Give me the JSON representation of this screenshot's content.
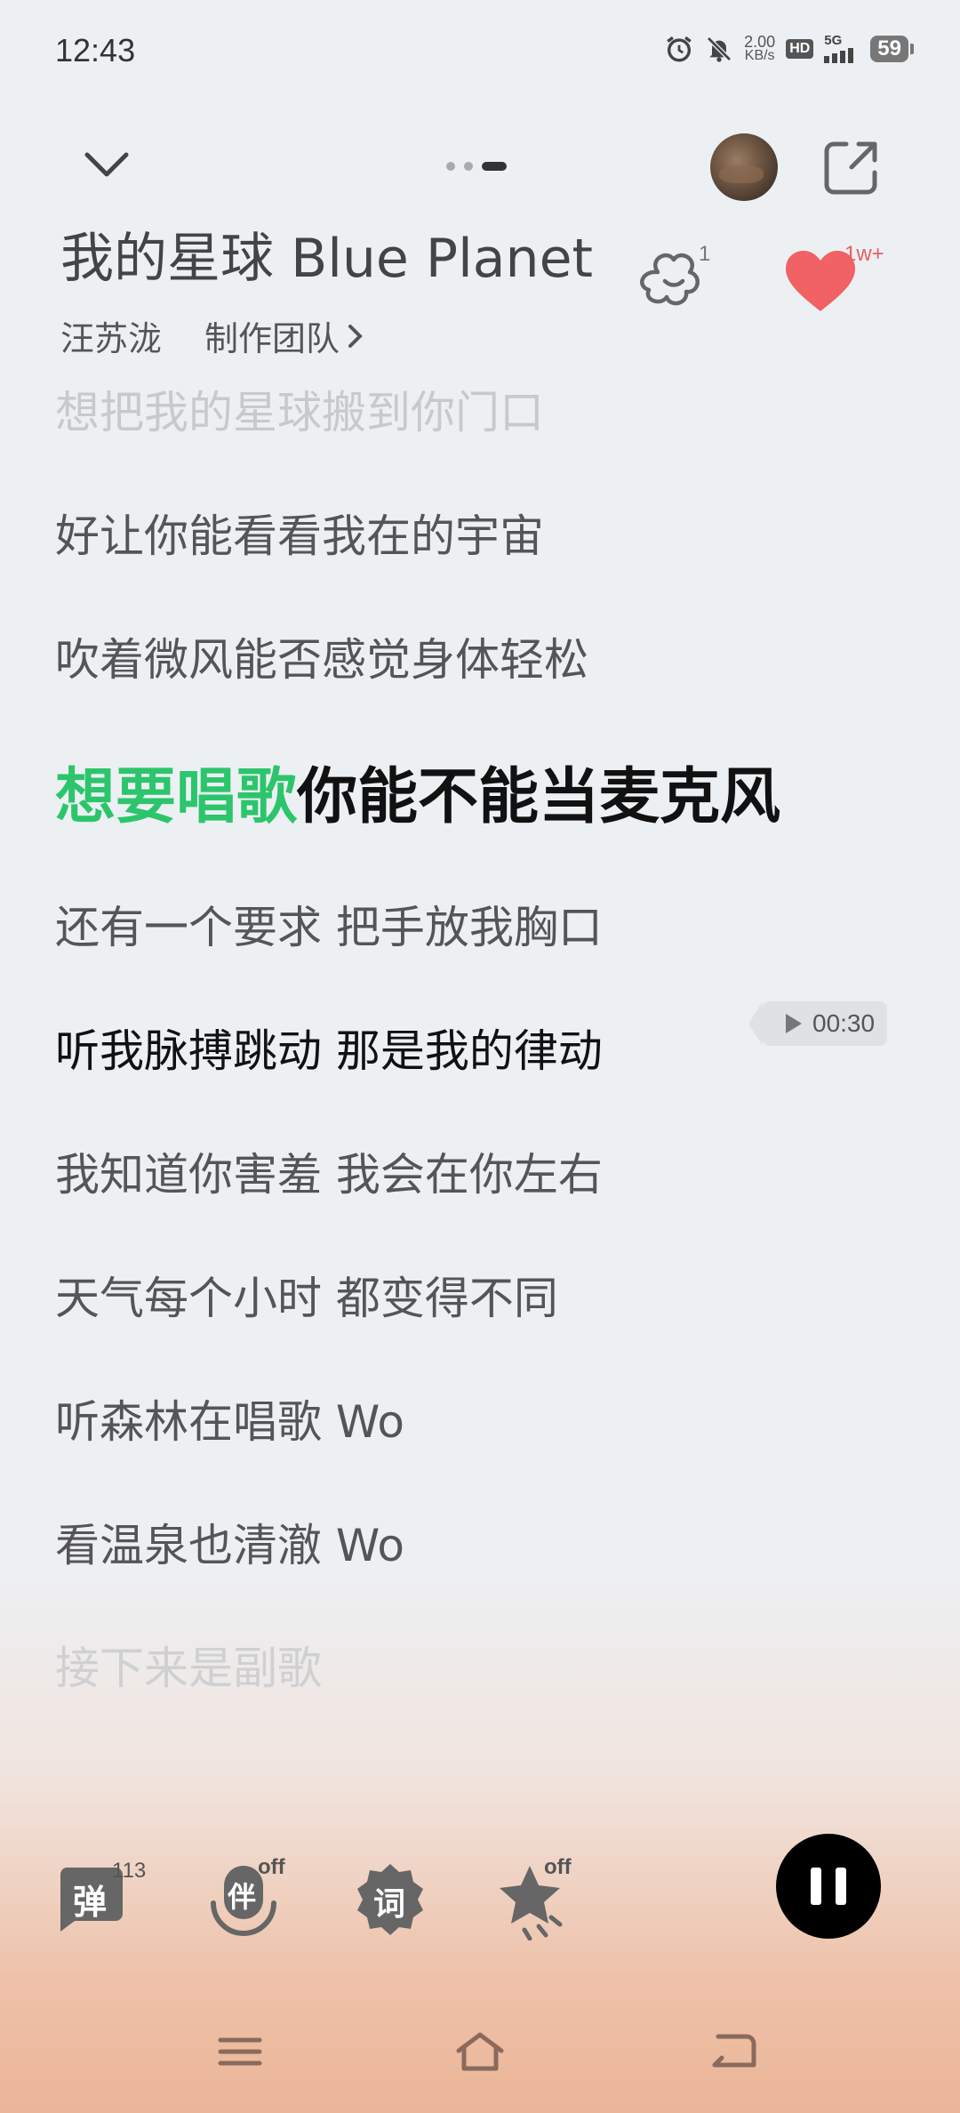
{
  "status_bar": {
    "time": "12:43",
    "net_speed_value": "2.00",
    "net_speed_unit": "KB/s",
    "hd_label": "HD",
    "network_label": "5G",
    "battery": "59"
  },
  "header": {
    "song_title": "我的星球 Blue Planet",
    "artist": "汪苏泷",
    "crew_label": "制作团队",
    "comment_count": "1",
    "like_count": "1w+"
  },
  "lyrics": [
    {
      "text": "想把我的星球搬到你门口",
      "state": "faded"
    },
    {
      "text": "好让你能看看我在的宇宙",
      "state": "normal"
    },
    {
      "text": "吹着微风能否感觉身体轻松",
      "state": "normal"
    },
    {
      "sung": "想要唱歌",
      "rest": "你能不能当麦克风",
      "state": "current"
    },
    {
      "text": "还有一个要求 把手放我胸口",
      "state": "normal"
    },
    {
      "text": "听我脉搏跳动 那是我的律动",
      "state": "dark"
    },
    {
      "text": "我知道你害羞 我会在你左右",
      "state": "normal"
    },
    {
      "text": "天气每个小时 都变得不同",
      "state": "normal"
    },
    {
      "text": "听森林在唱歌 Wo",
      "state": "normal"
    },
    {
      "text": "看温泉也清澈 Wo",
      "state": "normal"
    },
    {
      "text": "接下来是副歌",
      "state": "faded"
    }
  ],
  "seek_tag": {
    "time": "00:30"
  },
  "controls": {
    "danmu_label": "弹",
    "danmu_count": "113",
    "accompany_label": "伴",
    "accompany_state": "off",
    "lyrics_label": "词",
    "effect_state": "off"
  },
  "colors": {
    "accent_green": "#2cc56c",
    "like_red": "#f06264"
  }
}
